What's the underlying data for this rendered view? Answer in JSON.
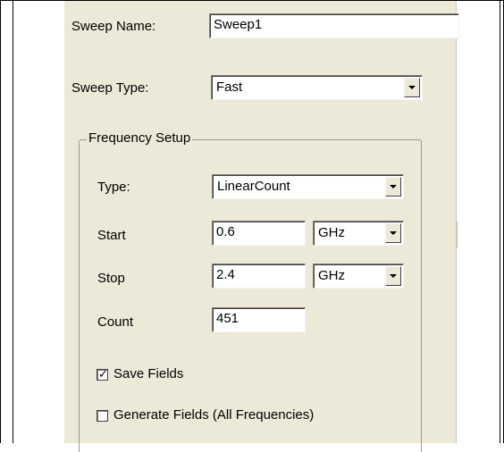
{
  "sweep_name": {
    "label": "Sweep Name:",
    "value": "Sweep1"
  },
  "sweep_type": {
    "label": "Sweep Type:",
    "value": "Fast"
  },
  "frequency_setup": {
    "title": "Frequency Setup",
    "type": {
      "label": "Type:",
      "value": "LinearCount"
    },
    "start": {
      "label": "Start",
      "value": "0.6",
      "unit": "GHz"
    },
    "stop": {
      "label": "Stop",
      "value": "2.4",
      "unit": "GHz"
    },
    "count": {
      "label": "Count",
      "value": "451"
    }
  },
  "save_fields": {
    "label": "Save Fields",
    "checked": true
  },
  "generate_fields": {
    "label": "Generate Fields (All Frequencies)",
    "checked": false
  },
  "colors": {
    "panel": "#ece9d8",
    "field": "#ffffff",
    "border": "#7f7f7f"
  },
  "icons": {
    "dropdown": "chevron-down-icon",
    "check": "checkmark-icon"
  }
}
